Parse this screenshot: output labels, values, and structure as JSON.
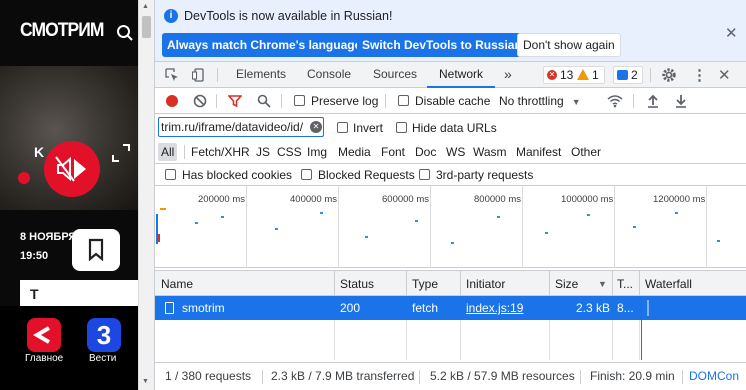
{
  "site": {
    "logo": "СМОТРИМ",
    "date": "8 НОЯБРЯ",
    "time": "19:50",
    "card_text": "Т",
    "apps": [
      {
        "label": "Главное",
        "color": "#e3102a"
      },
      {
        "label": "Вести",
        "color": "#1c47e0"
      }
    ]
  },
  "banner": {
    "text": "DevTools is now available in Russian!",
    "btn_match": "Always match Chrome's language",
    "btn_switch": "Switch DevTools to Russian",
    "btn_dont": "Don't show again"
  },
  "tabs": {
    "items": [
      "Elements",
      "Console",
      "Sources",
      "Network"
    ],
    "active": "Network",
    "more": "»",
    "errors": "13",
    "warnings": "1",
    "messages": "2"
  },
  "toolbar": {
    "preserve_log": "Preserve log",
    "disable_cache": "Disable cache",
    "throttling": "No throttling"
  },
  "filter": {
    "value": "trim.ru/iframe/datavideo/id/",
    "invert": "Invert",
    "hide_data_urls": "Hide data URLs"
  },
  "types": [
    "All",
    "Fetch/XHR",
    "JS",
    "CSS",
    "Img",
    "Media",
    "Font",
    "Doc",
    "WS",
    "Wasm",
    "Manifest",
    "Other"
  ],
  "blocked": {
    "has_blocked_cookies": "Has blocked cookies",
    "blocked_requests": "Blocked Requests",
    "third_party": "3rd-party requests"
  },
  "overview": {
    "ticks": [
      "200000 ms",
      "400000 ms",
      "600000 ms",
      "800000 ms",
      "1000000 ms",
      "1200000 ms"
    ]
  },
  "table": {
    "headers": [
      "Name",
      "Status",
      "Type",
      "Initiator",
      "Size",
      "T...",
      "Waterfall"
    ],
    "rows": [
      {
        "name": "smotrim",
        "status": "200",
        "type": "fetch",
        "initiator": "index.js:19",
        "size": "2.3 kB",
        "time": "8..."
      }
    ]
  },
  "status_bar": {
    "requests": "1 / 380 requests",
    "transferred": "2.3 kB / 7.9 MB transferred",
    "resources": "5.2 kB / 57.9 MB resources",
    "finish": "Finish: 20.9 min",
    "domcontent": "DOMCon"
  },
  "colors": {
    "accent": "#1a73e8",
    "record": "#d93025",
    "brand_red": "#e3102a"
  }
}
